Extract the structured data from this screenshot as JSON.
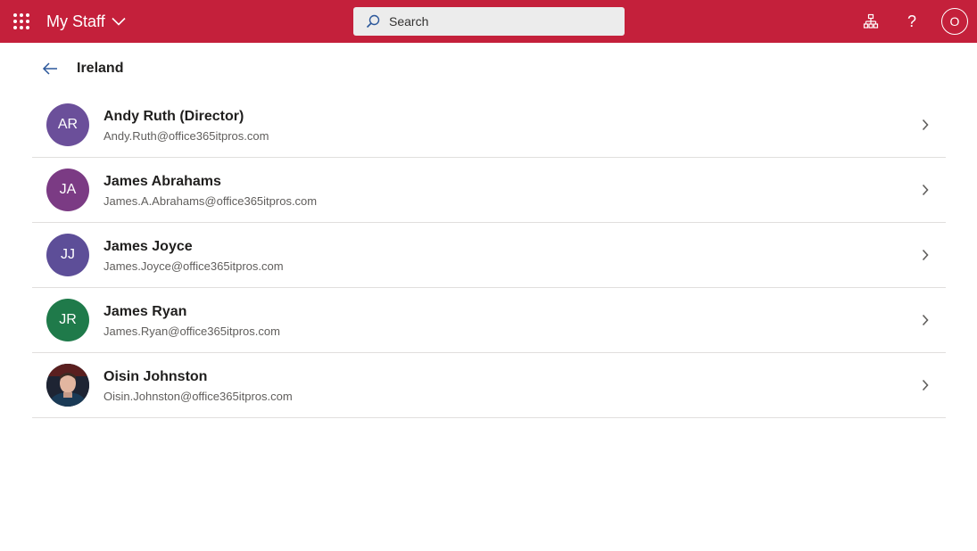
{
  "topbar": {
    "app_title": "My Staff",
    "search_placeholder": "Search",
    "user_initial": "O",
    "background_color": "#c4203b"
  },
  "page": {
    "title": "Ireland"
  },
  "staff": [
    {
      "initials": "AR",
      "name": "Andy Ruth (Director)",
      "email": "Andy.Ruth@office365itpros.com",
      "avatar_color": "#6b4f9a",
      "has_photo": false
    },
    {
      "initials": "JA",
      "name": "James Abrahams",
      "email": "James.A.Abrahams@office365itpros.com",
      "avatar_color": "#7b3b84",
      "has_photo": false
    },
    {
      "initials": "JJ",
      "name": "James Joyce",
      "email": "James.Joyce@office365itpros.com",
      "avatar_color": "#5d4e98",
      "has_photo": false
    },
    {
      "initials": "JR",
      "name": "James Ryan",
      "email": "James.Ryan@office365itpros.com",
      "avatar_color": "#1f7a4a",
      "has_photo": false
    },
    {
      "initials": "",
      "name": "Oisin Johnston",
      "email": "Oisin.Johnston@office365itpros.com",
      "avatar_color": "#2a3142",
      "has_photo": true
    }
  ],
  "icons": {
    "app_launcher": "waffle-icon",
    "title_dropdown": "chevron-down-icon",
    "search": "search-icon",
    "org_chart": "org-chart-icon",
    "help": "help-icon",
    "back": "back-arrow-icon",
    "row_open": "chevron-right-icon"
  }
}
